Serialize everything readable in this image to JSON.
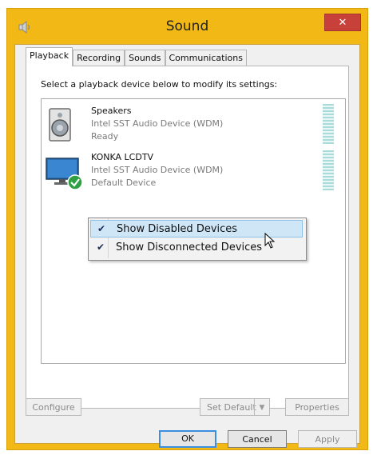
{
  "window": {
    "title": "Sound",
    "close_label": "✕",
    "accent": "#f1b816"
  },
  "tabs": [
    {
      "label": "Playback"
    },
    {
      "label": "Recording"
    },
    {
      "label": "Sounds"
    },
    {
      "label": "Communications"
    }
  ],
  "panel": {
    "instruction": "Select a playback device below to modify its settings:"
  },
  "devices": [
    {
      "name": "Speakers",
      "description": "Intel SST Audio Device (WDM)",
      "status": "Ready",
      "icon": "speaker-icon"
    },
    {
      "name": "KONKA LCDTV",
      "description": "Intel SST Audio Device (WDM)",
      "status": "Default Device",
      "icon": "monitor-icon",
      "default": true
    }
  ],
  "context_menu": {
    "items": [
      {
        "label": "Show Disabled Devices",
        "checked": true,
        "highlighted": true
      },
      {
        "label": "Show Disconnected Devices",
        "checked": true,
        "highlighted": false
      }
    ]
  },
  "buttons": {
    "configure": "Configure",
    "set_default": "Set Default",
    "properties": "Properties",
    "ok": "OK",
    "cancel": "Cancel",
    "apply": "Apply"
  }
}
